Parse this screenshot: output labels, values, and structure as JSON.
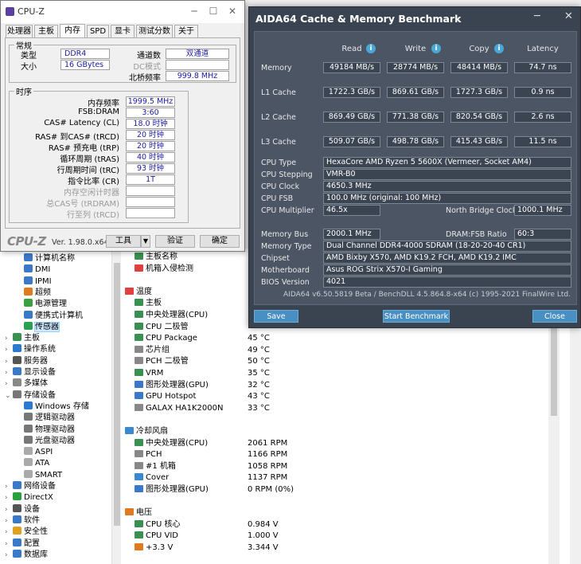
{
  "cpuz": {
    "title": "CPU-Z",
    "tabs": [
      "处理器",
      "主板",
      "内存",
      "SPD",
      "显卡",
      "测试分数",
      "关于"
    ],
    "active_tab": "内存",
    "general_label": "常规",
    "type_label": "类型",
    "type_value": "DDR4",
    "size_label": "大小",
    "size_value": "16 GBytes",
    "channels_label": "通道数",
    "channels_value": "双通道",
    "dc_mode_label": "DC模式",
    "dc_mode_value": "",
    "nb_freq_label": "北桥频率",
    "nb_freq_value": "999.8 MHz",
    "timings_label": "时序",
    "timings": [
      {
        "label": "内存频率",
        "value": "1999.5 MHz",
        "dim": false
      },
      {
        "label": "FSB:DRAM",
        "value": "3:60",
        "dim": false
      },
      {
        "label": "CAS# Latency (CL)",
        "value": "18.0 时钟",
        "dim": false
      },
      {
        "label": "RAS# 到CAS# (tRCD)",
        "value": "20 时钟",
        "dim": false
      },
      {
        "label": "RAS# 预充电 (tRP)",
        "value": "20 时钟",
        "dim": false
      },
      {
        "label": "循环周期 (tRAS)",
        "value": "40 时钟",
        "dim": false
      },
      {
        "label": "行周期时间 (tRC)",
        "value": "93 时钟",
        "dim": false
      },
      {
        "label": "指令比率 (CR)",
        "value": "1T",
        "dim": false
      },
      {
        "label": "内存空闲计时器",
        "value": "",
        "dim": true
      },
      {
        "label": "总CAS号 (tRDRAM)",
        "value": "",
        "dim": true
      },
      {
        "label": "行至列 (tRCD)",
        "value": "",
        "dim": true
      }
    ],
    "logo": "CPU-Z",
    "version": "Ver. 1.98.0.x64",
    "tools_label": "工具",
    "validate_label": "验证",
    "ok_label": "确定"
  },
  "aida_tree": [
    {
      "label": "计算机名称",
      "indent": 3,
      "color": "#3a78c8"
    },
    {
      "label": "DMI",
      "indent": 3,
      "color": "#3a78c8"
    },
    {
      "label": "IPMI",
      "indent": 3,
      "color": "#3a78c8"
    },
    {
      "label": "超频",
      "indent": 3,
      "color": "#e07a20"
    },
    {
      "label": "电源管理",
      "indent": 3,
      "color": "#3aa040"
    },
    {
      "label": "便携式计算机",
      "indent": 3,
      "color": "#3a78c8"
    },
    {
      "label": "传感器",
      "indent": 3,
      "color": "#2aa050",
      "selected": true
    },
    {
      "label": "主板",
      "indent": 1,
      "color": "#3a9050",
      "twisty": "›"
    },
    {
      "label": "操作系统",
      "indent": 1,
      "color": "#2a7ad0",
      "twisty": "›"
    },
    {
      "label": "服务器",
      "indent": 1,
      "color": "#555",
      "twisty": "›"
    },
    {
      "label": "显示设备",
      "indent": 1,
      "color": "#3a78c8",
      "twisty": "›"
    },
    {
      "label": "多媒体",
      "indent": 1,
      "color": "#888",
      "twisty": "›"
    },
    {
      "label": "存储设备",
      "indent": 1,
      "color": "#777",
      "twisty": "⌄"
    },
    {
      "label": "Windows 存储",
      "indent": 3,
      "color": "#2a7ad0"
    },
    {
      "label": "逻辑驱动器",
      "indent": 3,
      "color": "#777"
    },
    {
      "label": "物理驱动器",
      "indent": 3,
      "color": "#777"
    },
    {
      "label": "光盘驱动器",
      "indent": 3,
      "color": "#777"
    },
    {
      "label": "ASPI",
      "indent": 3,
      "color": "#aaa"
    },
    {
      "label": "ATA",
      "indent": 3,
      "color": "#aaa"
    },
    {
      "label": "SMART",
      "indent": 3,
      "color": "#aaa"
    },
    {
      "label": "网络设备",
      "indent": 1,
      "color": "#3a78c8",
      "twisty": "›"
    },
    {
      "label": "DirectX",
      "indent": 1,
      "color": "#2aa040",
      "twisty": "›"
    },
    {
      "label": "设备",
      "indent": 1,
      "color": "#555",
      "twisty": "›"
    },
    {
      "label": "软件",
      "indent": 1,
      "color": "#3a78c8",
      "twisty": "›"
    },
    {
      "label": "安全性",
      "indent": 1,
      "color": "#e0a020",
      "twisty": "›"
    },
    {
      "label": "配置",
      "indent": 1,
      "color": "#3a78c8",
      "twisty": "›"
    },
    {
      "label": "数据库",
      "indent": 1,
      "color": "#3a78c8",
      "twisty": "›"
    }
  ],
  "aida_list": [
    {
      "label": "主板名称",
      "value": "",
      "indent": 1,
      "color": "#3a9050"
    },
    {
      "label": "机箱入侵检测",
      "value": "",
      "indent": 1,
      "color": "#e04040"
    },
    {
      "label": "",
      "value": "",
      "indent": 0,
      "color": ""
    },
    {
      "label": "温度",
      "value": "",
      "indent": 0,
      "color": "#e04040"
    },
    {
      "label": "主板",
      "value": "",
      "indent": 1,
      "color": "#3a9050"
    },
    {
      "label": "中央处理器(CPU)",
      "value": "",
      "indent": 1,
      "color": "#3a9050"
    },
    {
      "label": "CPU 二极管",
      "value": "",
      "indent": 1,
      "color": "#3a9050"
    },
    {
      "label": "CPU Package",
      "value": "45 °C",
      "indent": 1,
      "color": "#3a9050"
    },
    {
      "label": "芯片组",
      "value": "49 °C",
      "indent": 1,
      "color": "#888"
    },
    {
      "label": "PCH 二极管",
      "value": "50 °C",
      "indent": 1,
      "color": "#888"
    },
    {
      "label": "VRM",
      "value": "35 °C",
      "indent": 1,
      "color": "#3a9050"
    },
    {
      "label": "图形处理器(GPU)",
      "value": "32 °C",
      "indent": 1,
      "color": "#3a78c8"
    },
    {
      "label": "GPU Hotspot",
      "value": "43 °C",
      "indent": 1,
      "color": "#3a78c8"
    },
    {
      "label": "GALAX HA1K2000N",
      "value": "33 °C",
      "indent": 1,
      "color": "#888"
    },
    {
      "label": "",
      "value": "",
      "indent": 0,
      "color": ""
    },
    {
      "label": "冷却风扇",
      "value": "",
      "indent": 0,
      "color": "#3a88d0"
    },
    {
      "label": "中央处理器(CPU)",
      "value": "2061 RPM",
      "indent": 1,
      "color": "#3a9050"
    },
    {
      "label": "PCH",
      "value": "1166 RPM",
      "indent": 1,
      "color": "#888"
    },
    {
      "label": "#1 机箱",
      "value": "1058 RPM",
      "indent": 1,
      "color": "#888"
    },
    {
      "label": "Cover",
      "value": "1137 RPM",
      "indent": 1,
      "color": "#3a88d0"
    },
    {
      "label": "图形处理器(GPU)",
      "value": "0 RPM  (0%)",
      "indent": 1,
      "color": "#3a78c8"
    },
    {
      "label": "",
      "value": "",
      "indent": 0,
      "color": ""
    },
    {
      "label": "电压",
      "value": "",
      "indent": 0,
      "color": "#e07a20"
    },
    {
      "label": "CPU 核心",
      "value": "0.984 V",
      "indent": 1,
      "color": "#3a9050"
    },
    {
      "label": "CPU VID",
      "value": "1.000 V",
      "indent": 1,
      "color": "#3a9050"
    },
    {
      "label": "+3.3 V",
      "value": "3.344 V",
      "indent": 1,
      "color": "#e07a20"
    }
  ],
  "bench": {
    "title": "AIDA64 Cache & Memory Benchmark",
    "col_read": "Read",
    "col_write": "Write",
    "col_copy": "Copy",
    "col_latency": "Latency",
    "rows": [
      {
        "label": "Memory",
        "read": "49184 MB/s",
        "write": "28774 MB/s",
        "copy": "48414 MB/s",
        "latency": "74.7 ns"
      },
      {
        "label": "L1 Cache",
        "read": "1722.3 GB/s",
        "write": "869.61 GB/s",
        "copy": "1727.3 GB/s",
        "latency": "0.9 ns"
      },
      {
        "label": "L2 Cache",
        "read": "869.49 GB/s",
        "write": "771.38 GB/s",
        "copy": "820.54 GB/s",
        "latency": "2.6 ns"
      },
      {
        "label": "L3 Cache",
        "read": "509.07 GB/s",
        "write": "498.78 GB/s",
        "copy": "415.43 GB/s",
        "latency": "11.5 ns"
      }
    ],
    "cpu_type_label": "CPU Type",
    "cpu_type": "HexaCore AMD Ryzen 5 5600X  (Vermeer, Socket AM4)",
    "cpu_stepping_label": "CPU Stepping",
    "cpu_stepping": "VMR-B0",
    "cpu_clock_label": "CPU Clock",
    "cpu_clock": "4650.3 MHz",
    "cpu_fsb_label": "CPU FSB",
    "cpu_fsb": "100.0 MHz  (original: 100 MHz)",
    "cpu_mult_label": "CPU Multiplier",
    "cpu_mult": "46.5x",
    "nb_clock_label": "North Bridge Clock",
    "nb_clock": "1000.1 MHz",
    "mem_bus_label": "Memory Bus",
    "mem_bus": "2000.1 MHz",
    "dram_ratio_label": "DRAM:FSB Ratio",
    "dram_ratio": "60:3",
    "mem_type_label": "Memory Type",
    "mem_type": "Dual Channel DDR4-4000 SDRAM  (18-20-20-40 CR1)",
    "chipset_label": "Chipset",
    "chipset": "AMD Bixby X570, AMD K19.2 FCH, AMD K19.2 IMC",
    "motherboard_label": "Motherboard",
    "motherboard": "Asus ROG Strix X570-I Gaming",
    "bios_label": "BIOS Version",
    "bios": "4021",
    "footer": "AIDA64 v6.50.5819 Beta / BenchDLL 4.5.864.8-x64  (c) 1995-2021 FinalWire Ltd.",
    "save_label": "Save",
    "start_label": "Start Benchmark",
    "close_label": "Close"
  }
}
